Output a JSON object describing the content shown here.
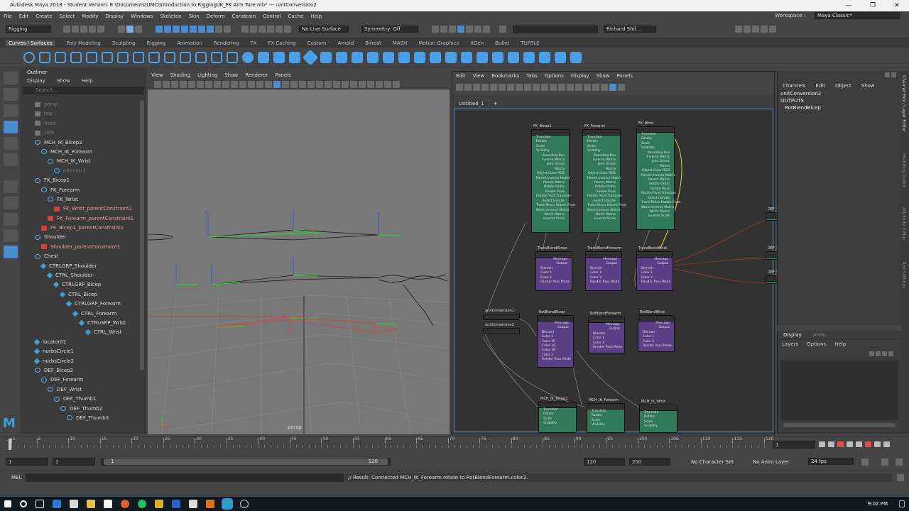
{
  "window": {
    "title": "Autodesk Maya 2018 - Student Version: E:\\Documents\\UMC\\Introduction to Rigging\\IK_FK Arm Tute.mb*   ---   unitConversion2",
    "controls": [
      "—",
      "❐",
      "✕"
    ]
  },
  "menubar": {
    "items": [
      "File",
      "Edit",
      "Create",
      "Select",
      "Modify",
      "Display",
      "Windows",
      "Skeleton",
      "Skin",
      "Deform",
      "Constrain",
      "Control",
      "Cache",
      "Help"
    ],
    "workspace_label": "Workspace :",
    "workspace_value": "Maya Classic*"
  },
  "statusline": {
    "menuset": "Rigging",
    "live_surface": "No Live Surface",
    "symmetry": "Symmetry: Off",
    "user": "Richard Shil..."
  },
  "shelf": {
    "tabs": [
      "Curves / Surfaces",
      "Poly Modeling",
      "Sculpting",
      "Rigging",
      "Animation",
      "Rendering",
      "FX",
      "FX Caching",
      "Custom",
      "Arnold",
      "Bifrost",
      "MASH",
      "Motion Graphics",
      "XGen",
      "Bullet",
      "TURTLE"
    ],
    "active_tab": "Curves / Surfaces"
  },
  "outliner": {
    "title": "Outliner",
    "menu": [
      "Display",
      "Show",
      "Help"
    ],
    "search_placeholder": "Search...",
    "items": [
      {
        "label": "persp",
        "indent": 1,
        "icon": "camera",
        "dim": true
      },
      {
        "label": "top",
        "indent": 1,
        "icon": "camera",
        "dim": true
      },
      {
        "label": "front",
        "indent": 1,
        "icon": "camera",
        "dim": true
      },
      {
        "label": "side",
        "indent": 1,
        "icon": "camera",
        "dim": true
      },
      {
        "label": "MCH_IK_Bicep2",
        "indent": 1,
        "icon": "joint"
      },
      {
        "label": "MCH_IK_Forearm",
        "indent": 2,
        "icon": "joint"
      },
      {
        "label": "MCH_IK_Wrist",
        "indent": 3,
        "icon": "joint"
      },
      {
        "label": "effector1",
        "indent": 4,
        "icon": "joint",
        "dim": true
      },
      {
        "label": "FK_Bicep1",
        "indent": 1,
        "icon": "joint"
      },
      {
        "label": "FK_Forearm",
        "indent": 2,
        "icon": "joint"
      },
      {
        "label": "FK_Wrist",
        "indent": 3,
        "icon": "joint"
      },
      {
        "label": "FK_Wrist_parentConstraint1",
        "indent": 4,
        "icon": "constraint"
      },
      {
        "label": "FK_Forearm_parentConstraint1",
        "indent": 3,
        "icon": "constraint"
      },
      {
        "label": "FK_Bicep1_parentConstraint1",
        "indent": 2,
        "icon": "constraint"
      },
      {
        "label": "Shoulder",
        "indent": 1,
        "icon": "joint"
      },
      {
        "label": "Shoulder_parentConstraint1",
        "indent": 2,
        "icon": "constraint"
      },
      {
        "label": "Chest",
        "indent": 1,
        "icon": "joint"
      },
      {
        "label": "CTRLGRP_Shoulder",
        "indent": 2,
        "icon": "curve"
      },
      {
        "label": "CTRL_Shoulder",
        "indent": 3,
        "icon": "curve"
      },
      {
        "label": "CTRLGRP_Bicep",
        "indent": 4,
        "icon": "curve"
      },
      {
        "label": "CTRL_Bicep",
        "indent": 5,
        "icon": "curve"
      },
      {
        "label": "CTRLGRP_Forearm",
        "indent": 6,
        "icon": "curve"
      },
      {
        "label": "CTRL_Forearm",
        "indent": 7,
        "icon": "curve"
      },
      {
        "label": "CTRLGRP_Wrist",
        "indent": 8,
        "icon": "curve"
      },
      {
        "label": "CTRL_Wrist",
        "indent": 9,
        "icon": "curve"
      },
      {
        "label": "locator01",
        "indent": 1,
        "icon": "curve"
      },
      {
        "label": "nurbsCircle1",
        "indent": 1,
        "icon": "curve"
      },
      {
        "label": "nurbsCircle2",
        "indent": 1,
        "icon": "curve"
      },
      {
        "label": "DEF_Bicep2",
        "indent": 1,
        "icon": "joint"
      },
      {
        "label": "DEF_Forearm",
        "indent": 2,
        "icon": "joint"
      },
      {
        "label": "DEF_Wrist",
        "indent": 3,
        "icon": "joint"
      },
      {
        "label": "DEF_Thumb1",
        "indent": 4,
        "icon": "joint"
      },
      {
        "label": "DEF_Thumb2",
        "indent": 5,
        "icon": "joint"
      },
      {
        "label": "DEF_Thumb3",
        "indent": 6,
        "icon": "joint"
      }
    ]
  },
  "viewport": {
    "menu": [
      "View",
      "Shading",
      "Lighting",
      "Show",
      "Renderer",
      "Panels"
    ],
    "camera_label": "persp",
    "axis_y": "y",
    "axis_z": "z"
  },
  "node_editor": {
    "menu": [
      "Edit",
      "View",
      "Bookmarks",
      "Tabs",
      "Options",
      "Display",
      "Show",
      "Panels"
    ],
    "tab": "Untitled_1",
    "tab_add": "+",
    "nodes": {
      "fk_bicep": {
        "title": "FK_Bicep1",
        "attrs": [
          "Translate",
          "Rotate",
          "Scale",
          "Visibility",
          "Bounding Box",
          "Inverse Matrix",
          "Joint Orient",
          "Matrix",
          "Object Color RGB",
          "Parent Inverse Matrix",
          "Parent Matrix",
          "Rotate Order",
          "Rotate Pivot",
          "Rotate Pivot Translate",
          "Select Handle",
          "Trans Minus Rotate Pivot",
          "World Inverse Matrix",
          "World Matrix",
          "Inverse Scale"
        ]
      },
      "fk_forearm": {
        "title": "FK_Forearm",
        "attrs": [
          "Translate",
          "Rotate",
          "Scale",
          "Visibility",
          "Bounding Box",
          "Inverse Matrix",
          "Joint Orient",
          "Matrix",
          "Object Color RGB",
          "Parent Inverse Matrix",
          "Parent Matrix",
          "Rotate Order",
          "Rotate Pivot",
          "Rotate Pivot Translate",
          "Select Handle",
          "Trans Minus Rotate Pivot",
          "World Inverse Matrix",
          "World Matrix",
          "Inverse Scale"
        ]
      },
      "fk_wrist": {
        "title": "FK_Wrist",
        "attrs": [
          "Translate",
          "Rotate",
          "Scale",
          "Visibility",
          "Bounding Box",
          "Inverse Matrix",
          "Joint Orient",
          "Matrix",
          "Object Color RGB",
          "Parent Inverse Matrix",
          "Parent Matrix",
          "Rotate Order",
          "Rotate Pivot",
          "Rotate Pivot Translate",
          "Select Handle",
          "Trans Minus Rotate Pivot",
          "World Inverse Matrix",
          "World Matrix",
          "Inverse Scale"
        ]
      },
      "tb_bicep": {
        "title": "TransBlendBicep",
        "attrs": [
          "Message",
          "Output",
          "Blender",
          "Color 1",
          "Color 2",
          "Render Pass Mode"
        ]
      },
      "tb_forearm": {
        "title": "TransBlendForearm",
        "attrs": [
          "Message",
          "Output",
          "Blender",
          "Color 1",
          "Color 2",
          "Render Pass Mode"
        ]
      },
      "tb_wrist": {
        "title": "TransBlendWrist",
        "attrs": [
          "Message",
          "Output",
          "Blender",
          "Color 1",
          "Color 2",
          "Render Pass Mode"
        ]
      },
      "uc1": {
        "title": "unitConversion1"
      },
      "uc2": {
        "title": "unitConversion2"
      },
      "rb_bicep": {
        "title": "RotBlendBicep",
        "attrs": [
          "Message",
          "Output",
          "Blender",
          "Color 1",
          "Color 1R",
          "Color 1G",
          "Color 1B",
          "Color 2",
          "Render Pass Mode"
        ]
      },
      "rb_forearm": {
        "title": "RotBlendForearm",
        "attrs": [
          "Message",
          "Output",
          "Blender",
          "Color 1",
          "Color 2",
          "Render Pass Mode"
        ]
      },
      "rb_wrist": {
        "title": "RotBlendWrist",
        "attrs": [
          "Message",
          "Output",
          "Blender",
          "Color 1",
          "Color 2",
          "Render Pass Mode"
        ]
      },
      "mch_bicep": {
        "title": "MCH_IK_Bicep2",
        "attrs": [
          "Translate",
          "Rotate",
          "Scale",
          "Visibility"
        ]
      },
      "mch_forearm": {
        "title": "MCH_IK_Forearm",
        "attrs": [
          "Translate",
          "Rotate",
          "Scale",
          "Visibility"
        ]
      },
      "mch_wrist": {
        "title": "MCH_IK_Wrist",
        "attrs": [
          "Translate",
          "Rotate",
          "Scale",
          "Visibility"
        ]
      },
      "def_a": {
        "title": "DEF_..."
      },
      "def_b": {
        "title": "DEF_F..."
      },
      "def_c": {
        "title": "DEF_W..."
      }
    }
  },
  "channel_box": {
    "menu": [
      "Channels",
      "Edit",
      "Object",
      "Show"
    ],
    "object": "unitConversion2",
    "outputs_label": "OUTPUTS",
    "output_item": "RotBlendBicep"
  },
  "layer_editor": {
    "tabs": [
      "Display",
      "Anim"
    ],
    "menu": [
      "Layers",
      "Options",
      "Help"
    ]
  },
  "side_tabs": [
    "Channel Box / Layer Editor",
    "Modeling Toolkit",
    "Attribute Editor",
    "Tool Settings"
  ],
  "timeline": {
    "ticks": [
      "1",
      "5",
      "10",
      "15",
      "20",
      "25",
      "30",
      "35",
      "40",
      "45",
      "50",
      "55",
      "60",
      "65",
      "70",
      "75",
      "80",
      "85",
      "90",
      "95",
      "100",
      "105",
      "110",
      "115",
      "120"
    ],
    "current_frame": "1"
  },
  "range": {
    "start": "1",
    "playback_start": "1",
    "range_start_label": "1",
    "range_end_label": "120",
    "playback_end": "120",
    "end": "200",
    "character_set": "No Character Set",
    "anim_layer": "No Anim Layer",
    "fps": "24 fps"
  },
  "command": {
    "label": "MEL",
    "result": "// Result: Connected MCH_IK_Forearm.rotate to RotBlendForearm.color2."
  },
  "taskbar": {
    "time": "9:02 PM"
  }
}
